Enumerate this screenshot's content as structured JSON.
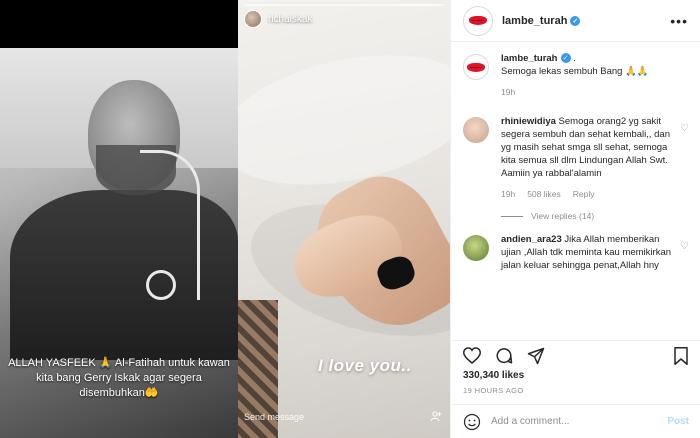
{
  "media": {
    "left_caption_line1": "ALLAH YASFEEK 🙏 Al-Fatihah untuk kawan",
    "left_caption_line2": "kita bang Gerry Iskak agar segera",
    "left_caption_line3": "disembuhkan🤲",
    "story_user": "richaiskak",
    "story_time": "13h",
    "story_text": "I love you..",
    "send_message": "Send message"
  },
  "header": {
    "username": "lambe_turah",
    "more_label": "•••"
  },
  "caption": {
    "username": "lambe_turah",
    "suffix": ".",
    "text": "Semoga lekas sembuh Bang 🙏🙏",
    "time": "19h"
  },
  "comments": [
    {
      "username": "rhiniewidiya",
      "text": "Semoga orang2 yg sakit segera sembuh dan sehat kembali,, dan yg masih sehat smga sll sehat, semoga kita semua sll dlm Lindungan Allah Swt. Aamiin ya rabbal'alamin",
      "time": "19h",
      "likes": "508 likes",
      "reply": "Reply",
      "view_replies": "View replies (14)"
    },
    {
      "username": "andien_ara23",
      "text": "Jika Allah memberikan ujian ,Allah tdk meminta kau memikirkan jalan keluar sehingga penat,Allah hny"
    }
  ],
  "likes": "330,340 likes",
  "time_ago": "19 HOURS AGO",
  "add_comment": {
    "placeholder": "Add a comment...",
    "post_label": "Post"
  },
  "colors": {
    "verified": "#3897f0",
    "brand_lips": "#e0112b",
    "muted": "#8e8e8e"
  }
}
